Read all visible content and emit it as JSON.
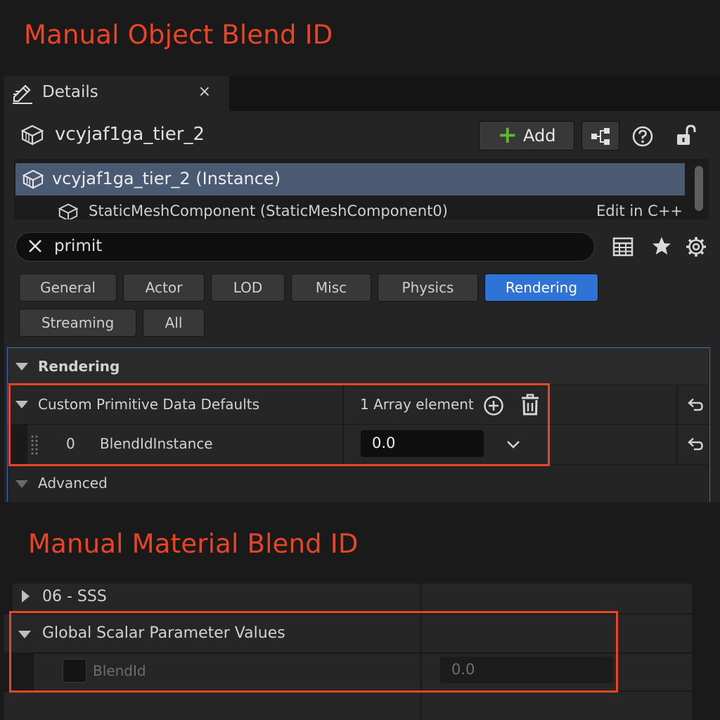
{
  "annotations": {
    "top_heading": "Manual Object Blend ID",
    "bottom_heading": "Manual Material Blend ID"
  },
  "details_tab": {
    "title": "Details",
    "close_glyph": "×"
  },
  "actor": {
    "name": "vcyjaf1ga_tier_2",
    "add_label": "Add"
  },
  "component_tree": {
    "selected": "vcyjaf1ga_tier_2 (Instance)",
    "child": "StaticMeshComponent (StaticMeshComponent0)",
    "child_action": "Edit in C++"
  },
  "search": {
    "value": "primit"
  },
  "filters": {
    "buttons": [
      "General",
      "Actor",
      "LOD",
      "Misc",
      "Physics",
      "Rendering",
      "Streaming",
      "All"
    ],
    "active": "Rendering"
  },
  "rendering_section": {
    "title": "Rendering",
    "custom_primitive": {
      "label": "Custom Primitive Data Defaults",
      "summary": "1 Array element"
    },
    "element": {
      "index": "0",
      "name": "BlendIdInstance",
      "value": "0.0"
    },
    "advanced_label": "Advanced"
  },
  "material_section": {
    "sss_label": "06 - SSS",
    "global_scalar_label": "Global Scalar Parameter Values",
    "param_name": "BlendId",
    "param_value": "0.0"
  },
  "colors": {
    "annotation_red": "#e84527",
    "active_filter_blue": "#2f73d7",
    "add_plus_green": "#5cb82c",
    "selected_row": "#4a5a73"
  }
}
